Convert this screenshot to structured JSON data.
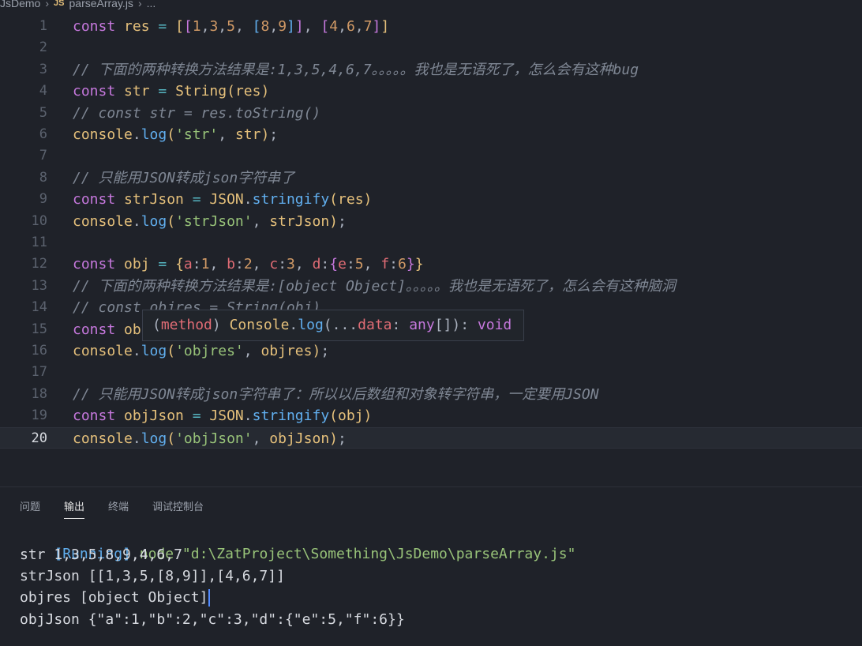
{
  "breadcrumb": {
    "folder": "JsDemo",
    "file_icon": "JS",
    "file": "parseArray.js",
    "trail": "..."
  },
  "editor": {
    "current_line": "20",
    "line_numbers": [
      "1",
      "2",
      "3",
      "4",
      "5",
      "6",
      "7",
      "8",
      "9",
      "10",
      "11",
      "12",
      "13",
      "14",
      "15",
      "16",
      "17",
      "18",
      "19",
      "20"
    ],
    "lines": [
      "const res = [[1,3,5, [8,9]], [4,6,7]]",
      "",
      "// 下面的两种转换方法结果是:1,3,5,4,6,7。。。。。我也是无语死了，怎么会有这种bug",
      "const str = String(res)",
      "// const str = res.toString()",
      "console.log('str', str);",
      "",
      "// 只能用JSON转成json字符串了",
      "const strJson = JSON.stringify(res)",
      "console.log('strJson', strJson);",
      "",
      "const obj = {a:1, b:2, c:3, d:{e:5, f:6}}",
      "// 下面的两种转换方法结果是:[object Object]。。。。。我也是无语死了，怎么会有这种脑洞",
      "// const objres = String(obj)",
      "const ob",
      "console.log('objres', objres);",
      "",
      "// 只能用JSON转成json字符串了：所以以后数组和对象转字符串，一定要用JSON",
      "const objJson = JSON.stringify(obj)",
      "console.log('objJson', objJson);"
    ]
  },
  "tooltip": {
    "text": "(method) Console.log(...data: any[]): void"
  },
  "panel": {
    "tabs": [
      "问题",
      "输出",
      "终端",
      "调试控制台"
    ],
    "active_tab": "输出",
    "running_tag": "[Running]",
    "command": "node \"d:\\ZatProject\\Something\\JsDemo\\parseArray.js\"",
    "output": [
      "str 1,3,5,8,9,4,6,7",
      "strJson [[1,3,5,[8,9]],[4,6,7]]",
      "objres [object Object]",
      "objJson {\"a\":1,\"b\":2,\"c\":3,\"d\":{\"e\":5,\"f\":6}}"
    ]
  },
  "colors": {
    "background": "#1f2229",
    "keyword": "#c678dd",
    "variable": "#e5c07b",
    "string": "#98c379",
    "function": "#61afef",
    "comment": "#7f8794",
    "number": "#d19a66"
  }
}
